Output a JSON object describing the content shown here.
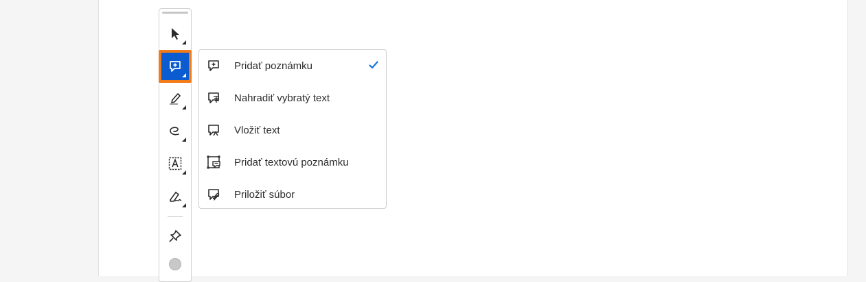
{
  "toolbar": {
    "tools": [
      {
        "name": "select-tool",
        "icon": "arrow-pointer-icon",
        "active": false
      },
      {
        "name": "add-note-tool",
        "icon": "comment-plus-icon",
        "active": true
      },
      {
        "name": "highlight-tool",
        "icon": "highlighter-icon",
        "active": false
      },
      {
        "name": "draw-tool",
        "icon": "freehand-loop-icon",
        "active": false
      },
      {
        "name": "text-box-tool",
        "icon": "text-box-icon",
        "active": false
      },
      {
        "name": "sign-tool",
        "icon": "pen-sign-icon",
        "active": false
      },
      {
        "name": "stamp-tool",
        "icon": "pin-icon",
        "active": false
      },
      {
        "name": "color-picker",
        "icon": "gray-circle-icon",
        "active": false
      }
    ],
    "active_color": "#0b5bd1",
    "focus_outline_color": "#f07c1a"
  },
  "menu": {
    "items": [
      {
        "label": "Pridať poznámku",
        "icon": "comment-plus-icon",
        "checked": true
      },
      {
        "label": "Nahradiť vybratý text",
        "icon": "comment-replace-text-icon",
        "checked": false
      },
      {
        "label": "Vložiť text",
        "icon": "comment-insert-text-icon",
        "checked": false
      },
      {
        "label": "Pridať textovú poznámku",
        "icon": "text-callout-icon",
        "checked": false
      },
      {
        "label": "Priložiť súbor",
        "icon": "comment-attach-icon",
        "checked": false
      }
    ],
    "check_color": "#1473e6"
  }
}
